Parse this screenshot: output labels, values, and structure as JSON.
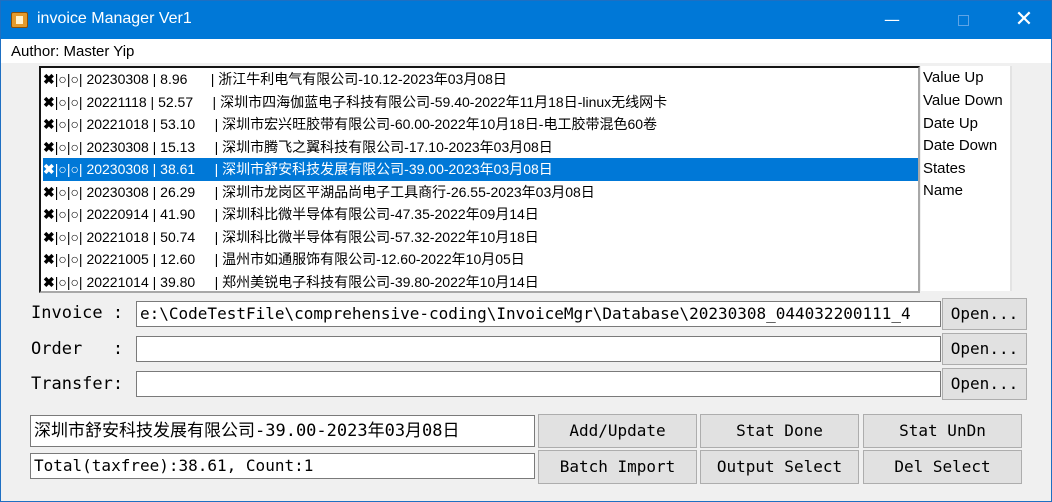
{
  "window": {
    "title": "invoice Manager Ver1",
    "minimize_glyph": "—",
    "close_glyph": "✕",
    "icon": "app-icon"
  },
  "menu": {
    "author": "Author: Master Yip"
  },
  "invoice_list": [
    {
      "mark": "✖",
      "text": "|○|○| 20230308 | 8.96      | 浙江牛利电气有限公司-10.12-2023年03月08日",
      "selected": false
    },
    {
      "mark": "✖",
      "text": "|○|○| 20221118 | 52.57     | 深圳市四海伽蓝电子科技有限公司-59.40-2022年11月18日-linux无线网卡",
      "selected": false
    },
    {
      "mark": "✖",
      "text": "|○|○| 20221018 | 53.10     | 深圳市宏兴旺胶带有限公司-60.00-2022年10月18日-电工胶带混色60卷",
      "selected": false
    },
    {
      "mark": "✖",
      "text": "|○|○| 20230308 | 15.13     | 深圳市腾飞之翼科技有限公司-17.10-2023年03月08日",
      "selected": false
    },
    {
      "mark": "✖",
      "text": "|○|○| 20230308 | 38.61     | 深圳市舒安科技发展有限公司-39.00-2023年03月08日",
      "selected": true
    },
    {
      "mark": "✖",
      "text": "|○|○| 20230308 | 26.29     | 深圳市龙岗区平湖品尚电子工具商行-26.55-2023年03月08日",
      "selected": false
    },
    {
      "mark": "✖",
      "text": "|○|○| 20220914 | 41.90     | 深圳科比微半导体有限公司-47.35-2022年09月14日",
      "selected": false
    },
    {
      "mark": "✖",
      "text": "|○|○| 20221018 | 50.74     | 深圳科比微半导体有限公司-57.32-2022年10月18日",
      "selected": false
    },
    {
      "mark": "✖",
      "text": "|○|○| 20221005 | 12.60     | 温州市如通服饰有限公司-12.60-2022年10月05日",
      "selected": false
    },
    {
      "mark": "✖",
      "text": "|○|○| 20221014 | 39.80     | 郑州美锐电子科技有限公司-39.80-2022年10月14日",
      "selected": false
    }
  ],
  "sort_options": [
    "Value Up",
    "Value Down",
    "Date Up",
    "Date Down",
    "States",
    "Name"
  ],
  "fields": {
    "invoice_label": "Invoice :",
    "invoice_value": "e:\\CodeTestFile\\comprehensive-coding\\InvoiceMgr\\Database\\20230308_044032200111_4",
    "order_label": "Order   :",
    "order_value": "",
    "transfer_label": "Transfer:",
    "transfer_value": "",
    "open_label": "Open..."
  },
  "selection_name": "深圳市舒安科技发展有限公司-39.00-2023年03月08日",
  "total_text": "Total(taxfree):38.61, Count:1",
  "buttons": {
    "add_update": "Add/Update",
    "stat_done": "Stat Done",
    "stat_undn": "Stat UnDn",
    "batch_import": "Batch Import",
    "output_select": "Output Select",
    "del_select": "Del Select"
  }
}
